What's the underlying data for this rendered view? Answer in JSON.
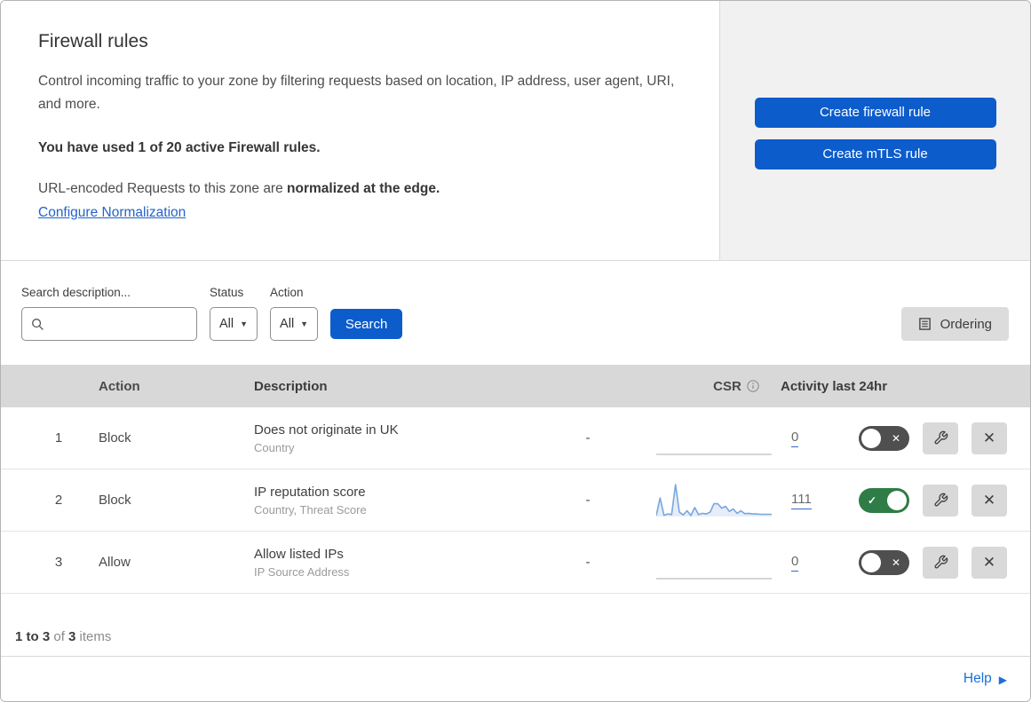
{
  "header": {
    "title": "Firewall rules",
    "description": "Control incoming traffic to your zone by filtering requests based on location, IP address, user agent, URI, and more.",
    "usage": "You have used 1 of 20 active Firewall rules.",
    "normalization_prefix": "URL-encoded Requests to this zone are ",
    "normalization_bold": "normalized at the edge.",
    "normalization_link": "Configure Normalization",
    "create_firewall_button": "Create firewall rule",
    "create_mtls_button": "Create mTLS rule"
  },
  "filters": {
    "search_label": "Search description...",
    "search_placeholder": "",
    "status_label": "Status",
    "status_value": "All",
    "action_label": "Action",
    "action_value": "All",
    "search_button": "Search",
    "ordering_button": "Ordering"
  },
  "table": {
    "headers": {
      "action": "Action",
      "description": "Description",
      "csr": "CSR",
      "activity": "Activity last 24hr"
    },
    "rows": [
      {
        "priority": "1",
        "action": "Block",
        "description": "Does not originate in UK",
        "match_fields": "Country",
        "csr": "-",
        "activity_count": "0",
        "enabled": false,
        "sparkline": []
      },
      {
        "priority": "2",
        "action": "Block",
        "description": "IP reputation score",
        "match_fields": "Country, Threat Score",
        "csr": "-",
        "activity_count": "111",
        "enabled": true,
        "sparkline": [
          3,
          58,
          4,
          8,
          6,
          100,
          14,
          5,
          18,
          3,
          28,
          6,
          10,
          8,
          14,
          40,
          40,
          26,
          32,
          16,
          24,
          10,
          18,
          9,
          10,
          8,
          8,
          7,
          7,
          7,
          7
        ]
      },
      {
        "priority": "3",
        "action": "Allow",
        "description": "Allow listed IPs",
        "match_fields": "IP Source Address",
        "csr": "-",
        "activity_count": "0",
        "enabled": false,
        "sparkline": []
      }
    ]
  },
  "footer": {
    "range": "1 to 3",
    "of": " of ",
    "total": "3",
    "items": " items",
    "help": "Help"
  },
  "glyphs": {
    "dropdown_arrow": "▼",
    "toggle_check": "✓",
    "toggle_x": "✕",
    "delete_x": "✕",
    "help_arrow": "▶"
  },
  "colors": {
    "accent_blue": "#0d5ccc",
    "link_blue": "#2264c8",
    "help_blue": "#1a6fd6",
    "toggle_on_green": "#2e7d46",
    "toggle_off_gray": "#4f4f4f",
    "sparkline_blue": "#78a7dd",
    "table_header_bg": "#d8d8d8",
    "panel_bg": "#f1f1f1"
  }
}
